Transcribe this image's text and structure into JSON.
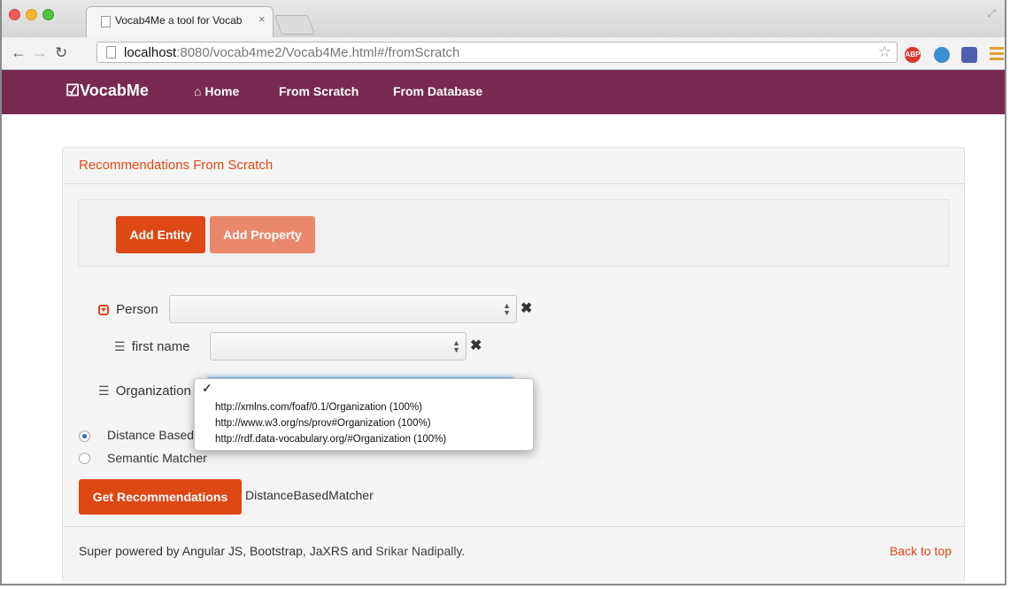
{
  "browser": {
    "tab_title": "Vocab4Me a tool for Vocab",
    "tab_close": "×",
    "url_host": "localhost",
    "url_rest": ":8080/vocab4me2/Vocab4Me.html#/fromScratch",
    "extensions": [
      "ABP",
      "",
      ""
    ]
  },
  "navbar": {
    "brand": "VocabMe",
    "home": "Home",
    "from_scratch": "From Scratch",
    "from_database": "From Database"
  },
  "panel": {
    "title": "Recommendations From Scratch",
    "add_entity": "Add Entity",
    "add_property": "Add Property",
    "entity_label": "Person",
    "property_label": "first name",
    "organization_label": "Organization",
    "radio_distance": "Distance Based Matcher",
    "radio_semantic": "Semantic Matcher",
    "get_recommendations": "Get Recommendations",
    "selected_matcher": "DistanceBasedMatcher"
  },
  "dropdown": {
    "checkmark": "✓",
    "options": [
      "http://xmlns.com/foaf/0.1/Organization (100%)",
      "http://www.w3.org/ns/prov#Organization (100%)",
      "http://rdf.data-vocabulary.org/#Organization (100%)"
    ]
  },
  "footer": {
    "text": "Super powered by Angular JS, Bootstrap, JaXRS and",
    "author": "Srikar Nadipally.",
    "back_to_top": "Back to top"
  }
}
